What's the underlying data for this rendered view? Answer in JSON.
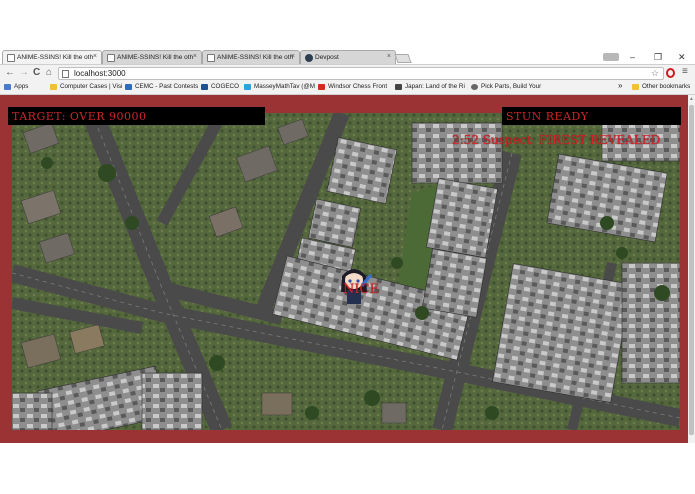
{
  "browser": {
    "tabs": [
      {
        "title": "ANIME-SSINS! Kill the oth",
        "active": true
      },
      {
        "title": "ANIME-SSINS! Kill the oth",
        "active": false
      },
      {
        "title": "ANIME-SSINS! Kill the oth",
        "active": false
      },
      {
        "title": "Devpost",
        "active": false
      }
    ],
    "tab_close": "×",
    "window_controls": {
      "minimize": "–",
      "restore": "❐",
      "close": "✕"
    },
    "url": "localhost:3000",
    "nav": {
      "back": "←",
      "forward": "→",
      "reload": "C",
      "home": "⌂"
    },
    "star": "☆",
    "menu": "≡",
    "bookmarks": [
      {
        "label": "Apps",
        "color": "#4a7bd0"
      },
      {
        "label": "Computer Cases | Visi",
        "color": "#f2c12e"
      },
      {
        "label": "CEMC - Past Contests",
        "color": "#2a6ebb"
      },
      {
        "label": "COGECO",
        "color": "#1d4f91"
      },
      {
        "label": "MasseyMathTav (@M",
        "color": "#2aa3e6"
      },
      {
        "label": "Windsor Chess Front",
        "color": "#d52b1e"
      },
      {
        "label": "Japan: Land of the Ri",
        "color": "#444444"
      },
      {
        "label": "Pick Parts, Build Your",
        "color": "#666666"
      }
    ],
    "bookmarks_overflow": "»",
    "other_bookmarks": "Other bookmarks"
  },
  "game": {
    "target_label": "TARGET: OVER 90000",
    "stun_label": "STUN READY",
    "revealed_label": "2:52 Suspect: FIREST REVEALED",
    "player_label": "NICE",
    "colors": {
      "frame": "#9b3335",
      "hud_bg": "#000000",
      "hud_text": "#c8262a"
    }
  }
}
